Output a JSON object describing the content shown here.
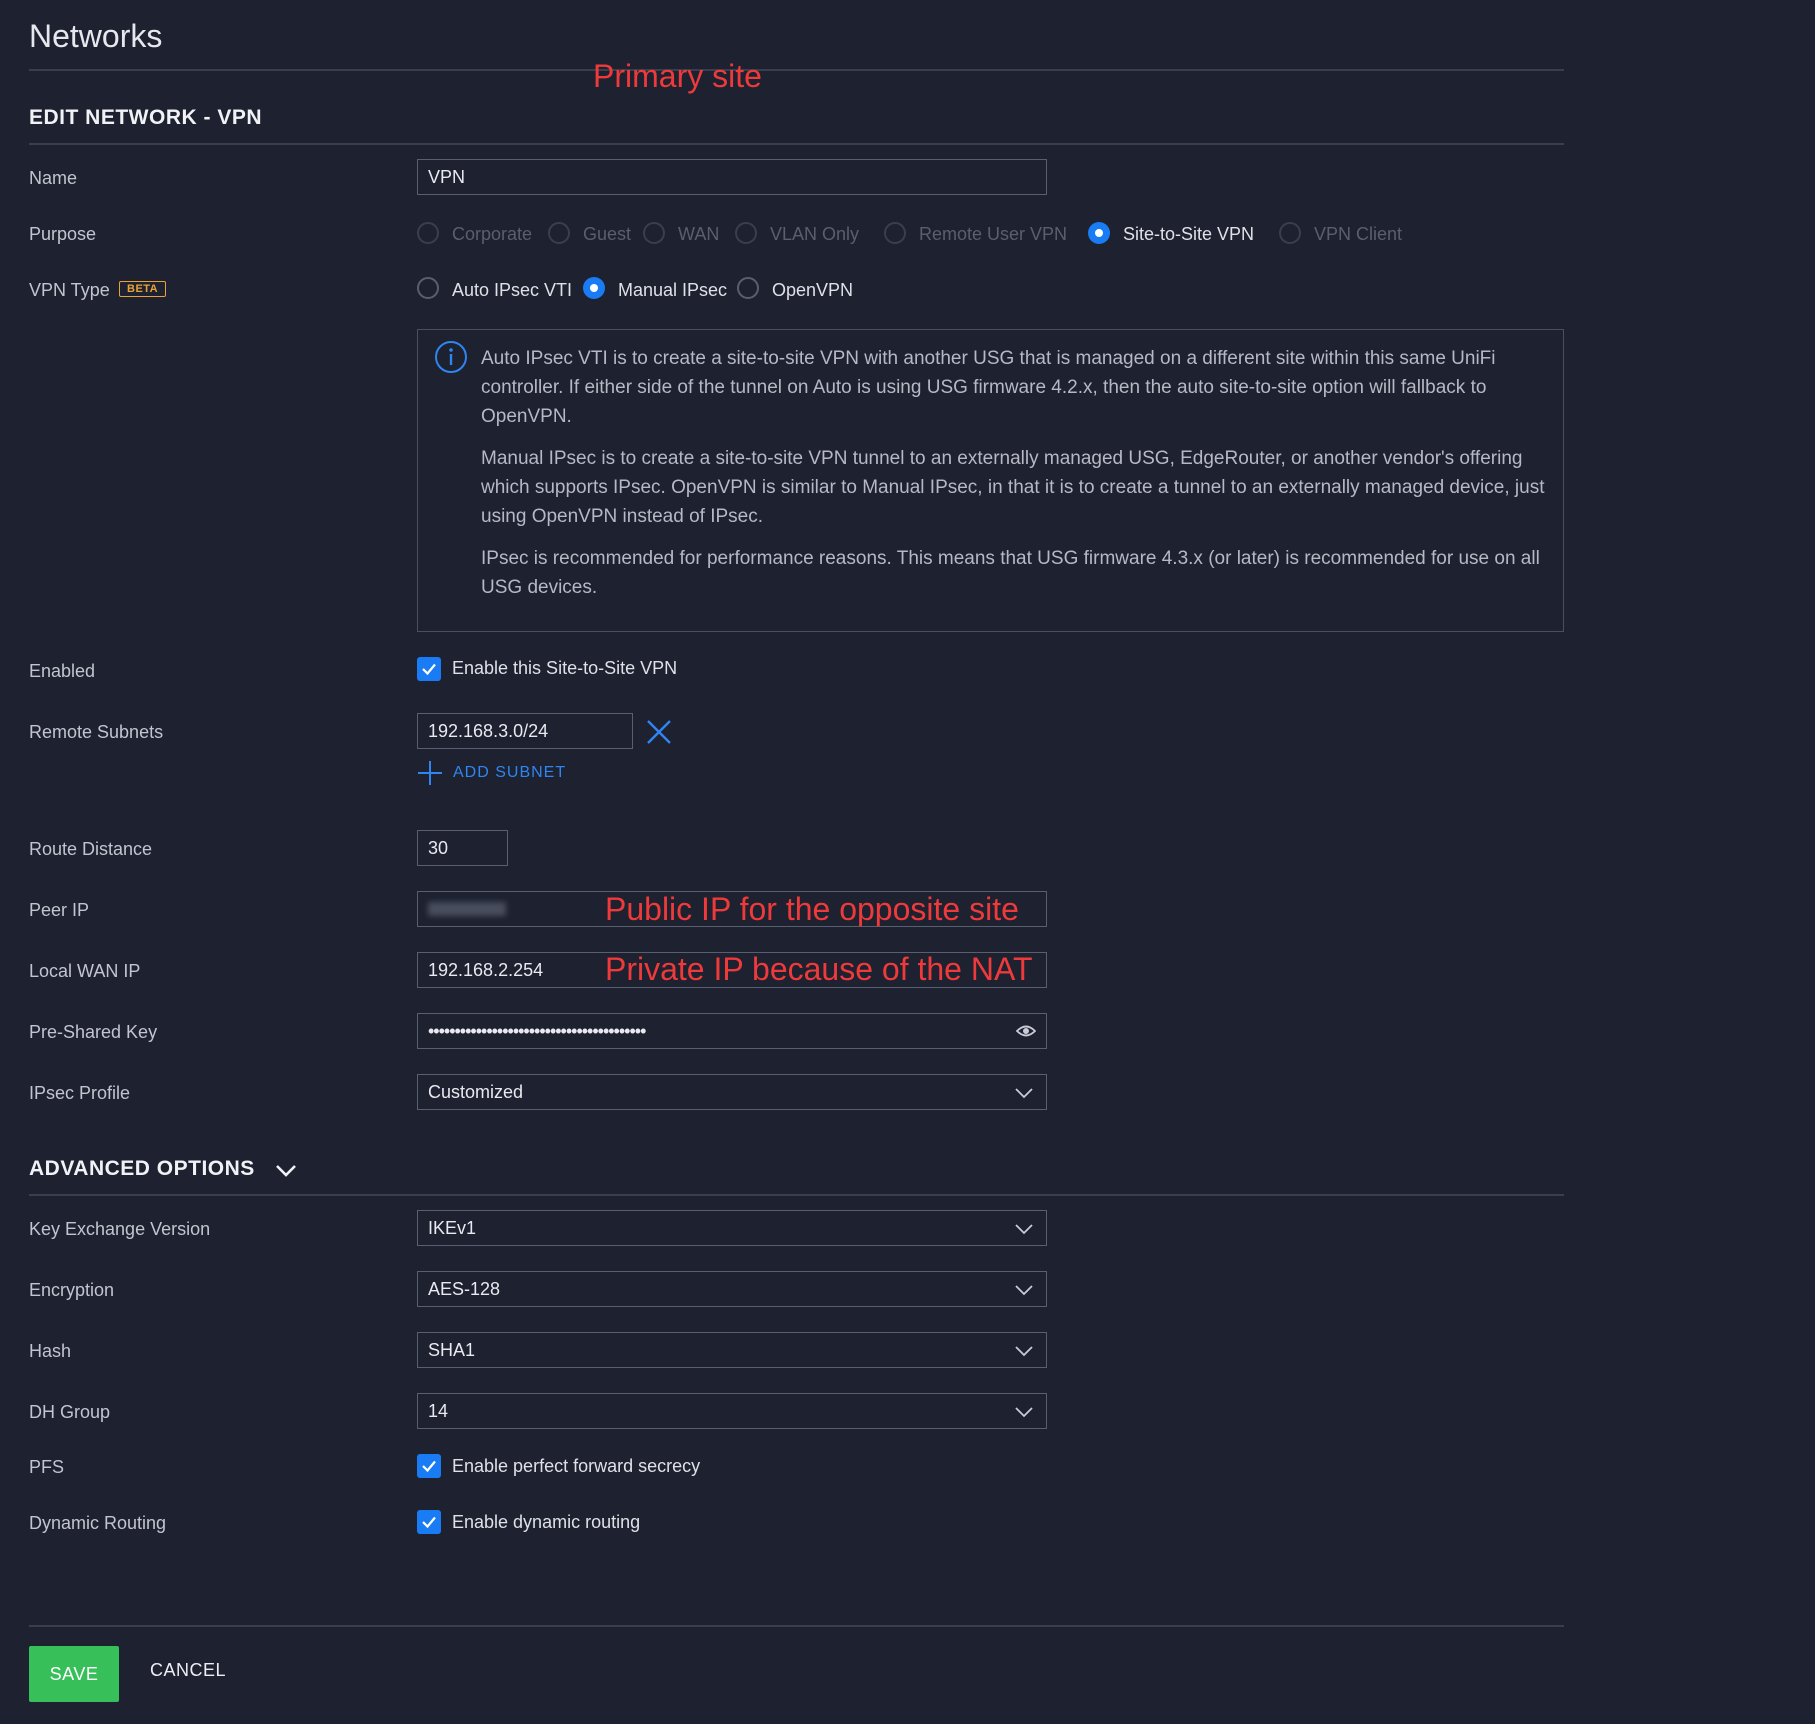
{
  "page": {
    "title": "Networks"
  },
  "annotations": {
    "primary_site": "Primary site",
    "peer_ip_note": "Public IP for the opposite site",
    "local_wan_note": "Private IP because of the NAT"
  },
  "section": {
    "title": "EDIT NETWORK - VPN"
  },
  "labels": {
    "name": "Name",
    "purpose": "Purpose",
    "vpn_type": "VPN Type",
    "beta": "BETA",
    "enabled": "Enabled",
    "remote_subnets": "Remote Subnets",
    "route_distance": "Route Distance",
    "peer_ip": "Peer IP",
    "local_wan_ip": "Local WAN IP",
    "pre_shared_key": "Pre-Shared Key",
    "ipsec_profile": "IPsec Profile",
    "key_exchange_version": "Key Exchange Version",
    "encryption": "Encryption",
    "hash": "Hash",
    "dh_group": "DH Group",
    "pfs": "PFS",
    "dynamic_routing": "Dynamic Routing"
  },
  "name": {
    "value": "VPN"
  },
  "purpose": {
    "options": [
      "Corporate",
      "Guest",
      "WAN",
      "VLAN Only",
      "Remote User VPN",
      "Site-to-Site VPN",
      "VPN Client"
    ],
    "selected": "Site-to-Site VPN"
  },
  "vpn_type": {
    "options": [
      "Auto IPsec VTI",
      "Manual IPsec",
      "OpenVPN"
    ],
    "selected": "Manual IPsec"
  },
  "info": {
    "p1": "Auto IPsec VTI is to create a site-to-site VPN with another USG that is managed on a different site within this same UniFi controller. If either side of the tunnel on Auto is using USG firmware 4.2.x, then the auto site-to-site option will fallback to OpenVPN.",
    "p2": "Manual IPsec is to create a site-to-site VPN tunnel to an externally managed USG, EdgeRouter, or another vendor's offering which supports IPsec. OpenVPN is similar to Manual IPsec, in that it is to create a tunnel to an externally managed device, just using OpenVPN instead of IPsec.",
    "p3": "IPsec is recommended for performance reasons. This means that USG firmware 4.3.x (or later) is recommended for use on all USG devices."
  },
  "enabled": {
    "label": "Enable this Site-to-Site VPN",
    "checked": true
  },
  "remote_subnets": {
    "values": [
      "192.168.3.0/24"
    ],
    "add_label": "ADD SUBNET"
  },
  "route_distance": {
    "value": "30"
  },
  "peer_ip": {
    "value": ""
  },
  "local_wan_ip": {
    "value": "192.168.2.254"
  },
  "pre_shared_key": {
    "masked": "•••••••••••••••••••••••••••••••••••••••••"
  },
  "ipsec_profile": {
    "value": "Customized"
  },
  "advanced": {
    "title": "ADVANCED OPTIONS"
  },
  "key_exchange_version": {
    "value": "IKEv1"
  },
  "encryption": {
    "value": "AES-128"
  },
  "hash": {
    "value": "SHA1"
  },
  "dh_group": {
    "value": "14"
  },
  "pfs": {
    "label": "Enable perfect forward secrecy",
    "checked": true
  },
  "dynamic_routing": {
    "label": "Enable dynamic routing",
    "checked": true
  },
  "buttons": {
    "save": "SAVE",
    "cancel": "CANCEL"
  },
  "colors": {
    "accent": "#1a7cf5",
    "save": "#37c05a",
    "annotation": "#ee3a3a",
    "beta": "#e8a237",
    "background": "#1d2130"
  },
  "icons": {
    "info": "info-icon",
    "remove": "close-icon",
    "add": "plus-icon",
    "select": "chevron-down-icon",
    "reveal": "eye-icon",
    "check": "check-icon"
  }
}
